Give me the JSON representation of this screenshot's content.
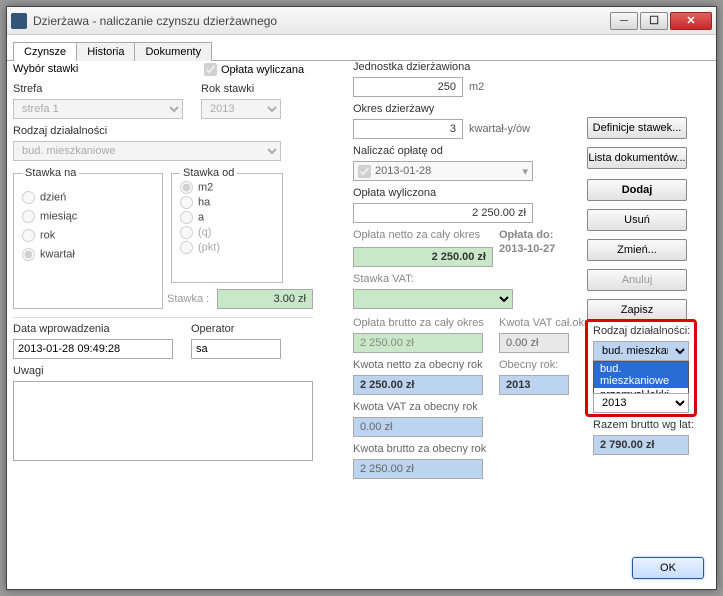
{
  "window": {
    "title": "Dzierżawa - naliczanie czynszu dzierżawnego"
  },
  "titlebar_icons": {
    "min": "─",
    "max": "☐",
    "close": "✕"
  },
  "tabs": [
    "Czynsze",
    "Historia",
    "Dokumenty"
  ],
  "left": {
    "wybor_stawki": "Wybór stawki",
    "oplata_wyliczana": "Opłata wyliczana",
    "strefa_label": "Strefa",
    "strefa_value": "strefa 1",
    "rok_stawki_label": "Rok stawki",
    "rok_stawki_value": "2013",
    "rodzaj_dzialalnosci_label": "Rodzaj działalności",
    "rodzaj_dzialalnosci_value": "bud. mieszkaniowe",
    "stawka_na_legend": "Stawka na",
    "stawka_na_options": [
      "dzień",
      "miesiąc",
      "rok",
      "kwartał"
    ],
    "stawka_od_legend": "Stawka od",
    "stawka_od_options": [
      "m2",
      "ha",
      "a",
      "(q)",
      "(pkt)"
    ],
    "stawka_label": "Stawka :",
    "stawka_value": "3.00 zł",
    "data_wprowadzenia_label": "Data wprowadzenia",
    "data_wprowadzenia_value": "2013-01-28 09:49:28",
    "operator_label": "Operator",
    "operator_value": "sa",
    "uwagi_label": "Uwagi"
  },
  "mid": {
    "jednostka_label": "Jednostka dzierżawiona",
    "jednostka_value": "250",
    "jednostka_unit": "m2",
    "okres_label": "Okres dzierżawy",
    "okres_value": "3",
    "okres_unit": "kwartał-y/ów",
    "naliczac_label": "Naliczać opłatę od",
    "naliczac_value": "2013-01-28",
    "oplata_wyliczona_label": "Opłata wyliczona",
    "oplata_wyliczona_value": "2 250.00 zł",
    "oplata_netto_okres_label": "Opłata netto za cały okres",
    "oplata_netto_okres_value": "2 250.00 zł",
    "oplata_do_label": "Opłata do:",
    "oplata_do_value": "2013-10-27",
    "stawka_vat_label": "Stawka VAT:",
    "oplata_brutto_okres_label": "Opłata brutto za cały okres",
    "oplata_brutto_okres_value": "2 250.00 zł",
    "kwota_vat_okres_label": "Kwota VAT cał.okr",
    "kwota_vat_okres_value": "0.00 zł",
    "kwota_netto_rok_label": "Kwota netto za obecny rok",
    "kwota_netto_rok_value": "2 250.00 zł",
    "obecny_rok_label": "Obecny rok:",
    "obecny_rok_value": "2013",
    "kwota_vat_rok_label": "Kwota VAT za obecny rok",
    "kwota_vat_rok_value": "0.00 zł",
    "kwota_brutto_rok_label": "Kwota brutto za obecny rok",
    "kwota_brutto_rok_value": "2 250.00 zł"
  },
  "right": {
    "buttons": {
      "definicje": "Definicje stawek...",
      "lista": "Lista dokumentów...",
      "dodaj": "Dodaj",
      "usun": "Usuń",
      "zmien": "Zmień...",
      "anuluj": "Anuluj",
      "zapisz": "Zapisz"
    },
    "rodzaj_label": "Rodzaj działalności:",
    "rodzaj_value": "bud. mieszkaniowe",
    "rodzaj_options": [
      "bud. mieszkaniowe",
      "przemysł lekki"
    ],
    "year_value": "2013",
    "razem_label": "Razem brutto wg lat:",
    "razem_value": "2 790.00 zł"
  },
  "footer": {
    "ok": "OK"
  }
}
